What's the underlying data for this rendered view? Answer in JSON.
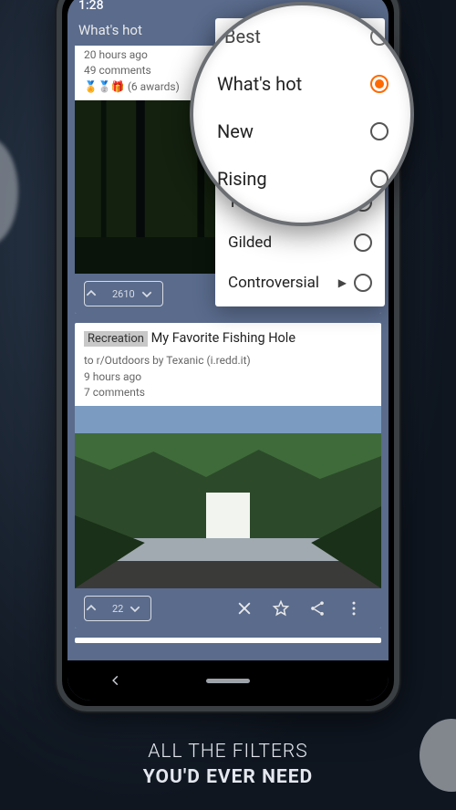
{
  "statusbar": {
    "time": "1:28"
  },
  "appbar": {
    "title": "What's hot"
  },
  "posts": [
    {
      "age": "20 hours ago",
      "comments": "49 comments",
      "awards_emoji": "🏅🥈🎁",
      "awards_text": "(6 awards)",
      "score": "2610"
    },
    {
      "tag": "Recreation",
      "title": "My Favorite Fishing Hole",
      "byline": "to r/Outdoors by Texanic  (i.redd.it)",
      "age": "9 hours ago",
      "comments": "7 comments",
      "score": "22"
    }
  ],
  "sort_menu": {
    "items": [
      {
        "label": "Best",
        "selected": false,
        "expandable": false
      },
      {
        "label": "What's hot",
        "selected": true,
        "expandable": false
      },
      {
        "label": "New",
        "selected": false,
        "expandable": false
      },
      {
        "label": "Rising",
        "selected": false,
        "expandable": false
      },
      {
        "label": "Top",
        "selected": false,
        "expandable": true
      },
      {
        "label": "Gilded",
        "selected": false,
        "expandable": false
      },
      {
        "label": "Controversial",
        "selected": false,
        "expandable": true
      }
    ]
  },
  "hero": {
    "line1": "ALL THE FILTERS",
    "line2": "YOU'D EVER NEED"
  }
}
